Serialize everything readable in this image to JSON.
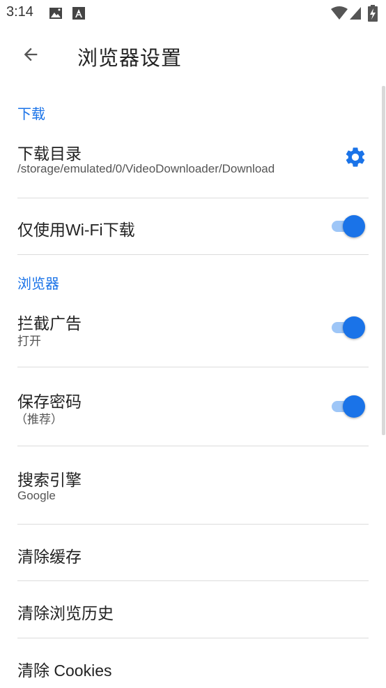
{
  "status_bar": {
    "time": "3:14",
    "icons": [
      "image-icon",
      "text-icon",
      "wifi-icon",
      "signal-icon",
      "battery-charging-icon"
    ]
  },
  "app_bar": {
    "title": "浏览器设置",
    "back_icon": "arrow-back-icon"
  },
  "accent_color": "#1a73e8",
  "sections": {
    "download": {
      "header": "下载",
      "directory": {
        "title": "下载目录",
        "path": "/storage/emulated/0/VideoDownloader/Download",
        "icon": "gear-icon"
      },
      "wifi_only": {
        "title": "仅使用Wi-Fi下载",
        "enabled": true
      }
    },
    "browser": {
      "header": "浏览器",
      "block_ads": {
        "title": "拦截广告",
        "summary": "打开",
        "enabled": true
      },
      "save_password": {
        "title": "保存密码",
        "summary": "（推荐）",
        "enabled": true
      },
      "search_engine": {
        "title": "搜索引擎",
        "summary": "Google"
      },
      "clear_cache": {
        "title": "清除缓存"
      },
      "clear_history": {
        "title": "清除浏览历史"
      },
      "clear_cookies": {
        "title": "清除 Cookies"
      }
    }
  }
}
